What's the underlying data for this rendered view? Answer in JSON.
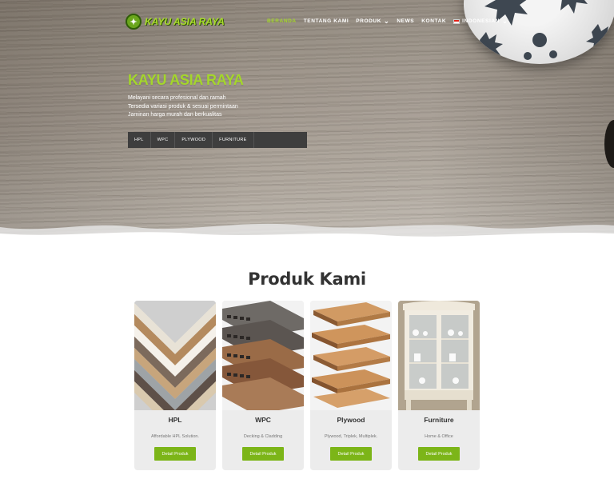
{
  "brand": {
    "logo_glyph": "✦",
    "name": "KAYU ASIA RAYA",
    "accent_color": "#a4d62b",
    "button_color": "#7cb518"
  },
  "nav": {
    "items": [
      {
        "label": "BERANDA",
        "active": true
      },
      {
        "label": "TENTANG KAMI",
        "active": false
      },
      {
        "label": "PRODUK",
        "active": false,
        "dropdown": true
      },
      {
        "label": "NEWS",
        "active": false
      },
      {
        "label": "KONTAK",
        "active": false
      },
      {
        "label": "INDONESIAN",
        "active": false,
        "flag": "id",
        "dropdown": true
      }
    ],
    "chevron": "⌄"
  },
  "hero": {
    "title": "KAYU ASIA RAYA",
    "lines": [
      "Melayani secara profesional dan ramah",
      "Tersedia variasi produk & sesuai permintaan",
      "Jaminan harga murah dan berkualitas"
    ],
    "tabs": [
      "HPL",
      "WPC",
      "PLYWOOD",
      "FURNITURE"
    ]
  },
  "products": {
    "title": "Produk Kami",
    "items": [
      {
        "name": "HPL",
        "desc": "Affordable HPL Solution.",
        "button": "Detail Produk",
        "image": "hpl-sheets-image"
      },
      {
        "name": "WPC",
        "desc": "Decking & Cladding",
        "button": "Detail Produk",
        "image": "wpc-decking-image"
      },
      {
        "name": "Plywood",
        "desc": "Plywood, Triplek, Multiplek.",
        "button": "Detail Produk",
        "image": "plywood-stack-image"
      },
      {
        "name": "Furniture",
        "desc": "Home & Office",
        "button": "Detail Produk",
        "image": "cabinet-image"
      }
    ]
  }
}
